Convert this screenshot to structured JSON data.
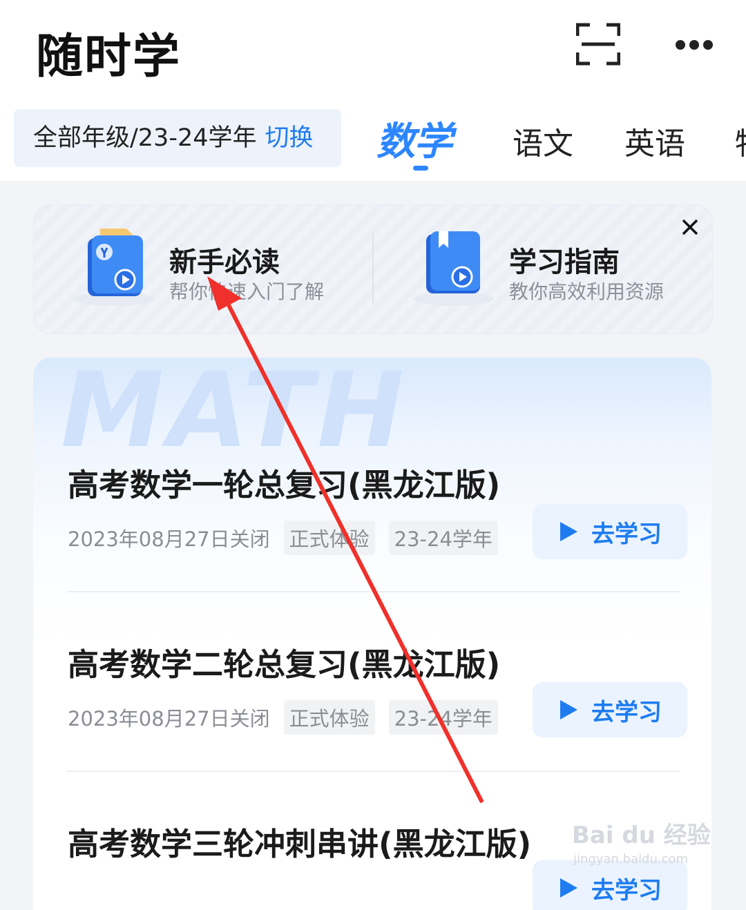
{
  "header": {
    "app_title": "随时学",
    "icons": [
      "scan-icon",
      "more-icon"
    ]
  },
  "grade_selector": {
    "label": "全部年级/23-24学年",
    "switch_label": "切换"
  },
  "subject_tabs": [
    {
      "label": "数学",
      "active": true
    },
    {
      "label": "语文",
      "active": false
    },
    {
      "label": "英语",
      "active": false
    },
    {
      "label": "物",
      "active": false
    }
  ],
  "guide": {
    "items": [
      {
        "title": "新手必读",
        "subtitle": "帮你快速入门了解",
        "icon": "folder-video-icon"
      },
      {
        "title": "学习指南",
        "subtitle": "教你高效利用资源",
        "icon": "book-video-icon"
      }
    ]
  },
  "course_card": {
    "watermark": "MATH",
    "courses": [
      {
        "title": "高考数学一轮总复习(黑龙江版)",
        "close_date": "2023年08月27日关闭",
        "tags": [
          "正式体验",
          "23-24学年"
        ],
        "button": "去学习"
      },
      {
        "title": "高考数学二轮总复习(黑龙江版)",
        "close_date": "2023年08月27日关闭",
        "tags": [
          "正式体验",
          "23-24学年"
        ],
        "button": "去学习"
      },
      {
        "title": "高考数学三轮冲刺串讲(黑龙江版)",
        "close_date": "",
        "tags": [],
        "button": "去学习"
      }
    ]
  },
  "watermark": {
    "brand": "Bai du 经验",
    "url": "jingyan.baidu.com"
  },
  "colors": {
    "accent": "#2d86ff",
    "annotation_arrow": "#f0302a"
  }
}
